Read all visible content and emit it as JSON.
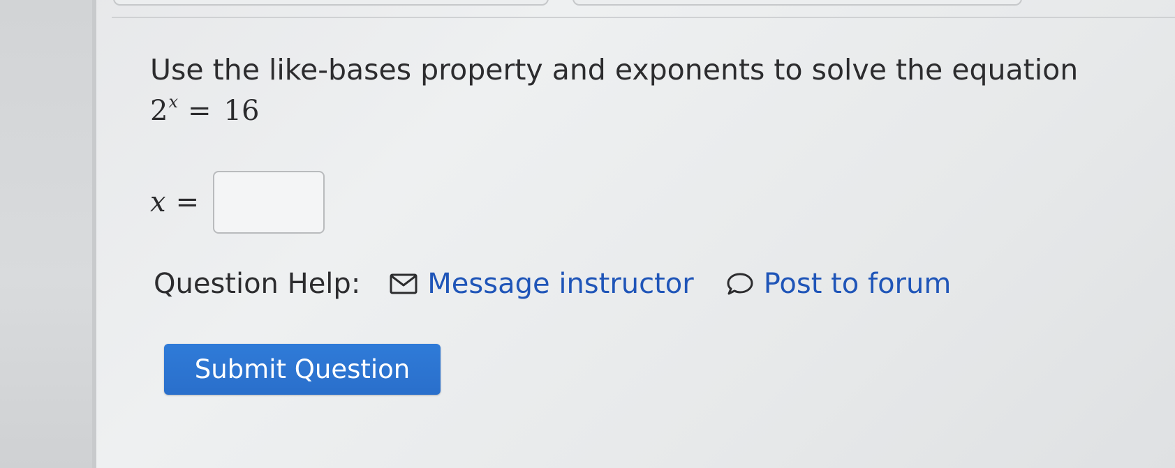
{
  "question": {
    "prompt": "Use the like-bases property and exponents to solve the equation",
    "equation": {
      "base": "2",
      "exponent": "x",
      "equals": "=",
      "rhs": "16"
    }
  },
  "answer": {
    "variable": "x",
    "equals": "=",
    "value": ""
  },
  "help": {
    "label": "Question Help:",
    "message_instructor": "Message instructor",
    "post_to_forum": "Post to forum"
  },
  "submit": {
    "label": "Submit Question"
  },
  "colors": {
    "link": "#1f55b8",
    "button": "#2a6fcb",
    "text": "#2c2c2e"
  }
}
